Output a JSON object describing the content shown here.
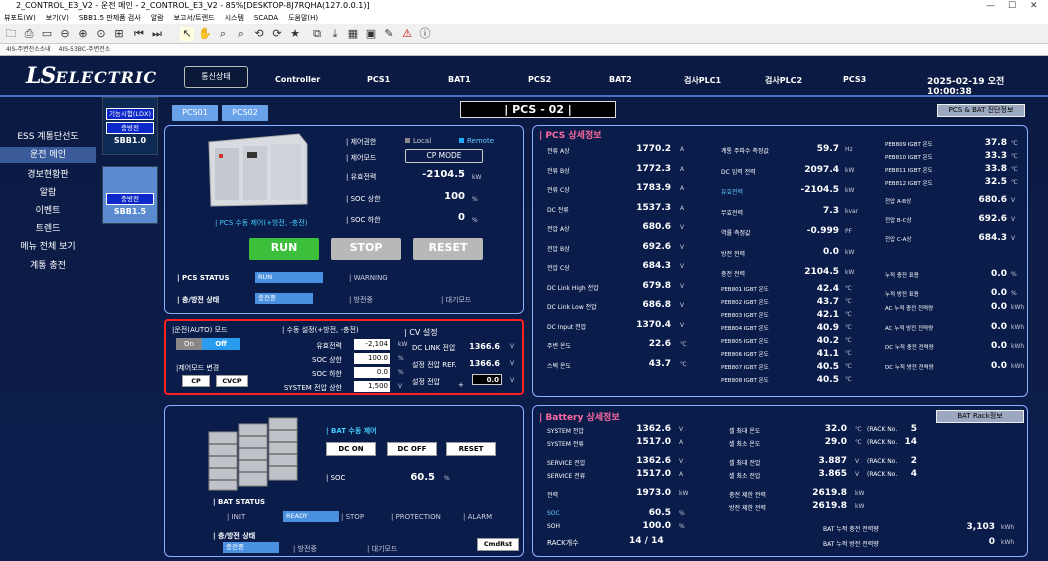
{
  "window": {
    "title": "2_CONTROL_E3_V2 - 운전 메인 - 2_CONTROL_E3_V2 - 85%[DESKTOP-8J7RQHA(127.0.0.1)]",
    "controls": [
      "—",
      "☐",
      "✕"
    ]
  },
  "menubar": [
    "뷰포트(W)",
    "보기(V)",
    "SBB1.5 판제품 검사",
    "알람",
    "보고서/트렌드",
    "시스템",
    "SCADA",
    "도움말(H)"
  ],
  "tabbar": [
    "4IS-주변전소소내",
    "4IS-53BC-주변전소"
  ],
  "header": {
    "logo_main": "LS",
    "logo_sub": "ELECTRIC",
    "nav": [
      "통신상태",
      "Controller",
      "PCS1",
      "BAT1",
      "PCS2",
      "BAT2",
      "검사PLC1",
      "검사PLC2",
      "PCS3"
    ],
    "datetime": "2025-02-19 오전 10:00:38"
  },
  "leftmenu": [
    "ESS 계통단선도",
    "운전 메인",
    "경보현황판",
    "알람",
    "이벤트",
    "트렌드",
    "메뉴 전체 보기",
    "계통 충전"
  ],
  "sbb": [
    {
      "badge1": "기능시험(LDX)",
      "badge2": "충방전",
      "name": "SBB1.0"
    },
    {
      "badge1": "충방전",
      "name": "SBB1.5"
    }
  ],
  "pcs_tabs": [
    "PCS01",
    "PCS02"
  ],
  "pcs_title": "|  PCS - 02  |",
  "diag_button": "PCS & BAT 진단정보",
  "pcs_panel": {
    "auth_label": "| 제어권한",
    "local": "Local",
    "remote": "Remote",
    "mode_label": "| 제어모드",
    "mode_value": "CP MODE",
    "power_label": "| 유효전력",
    "power_value": "-2104.5",
    "power_unit": "kW",
    "soc_hi_label": "| SOC 상한",
    "soc_hi_value": "100",
    "soc_hi_unit": "%",
    "soc_lo_label": "| SOC 하한",
    "soc_lo_value": "0",
    "soc_lo_unit": "%",
    "manual_label": "| PCS 수동 제어(+방전, -충전)",
    "run": "RUN",
    "stop": "STOP",
    "reset": "RESET",
    "status_label": "| PCS STATUS",
    "status_run": "RUN",
    "status_warn": "| WARNING",
    "cd_label": "| 충/방전 상태",
    "cd_charge": "충전중",
    "cd_discharge": "| 방전중",
    "cd_idle": "| 대기모드"
  },
  "auto_panel": {
    "auto_label": "|운전(AUTO) 모드",
    "on": "On",
    "off": "Off",
    "ctrl_label": "|제어모드 변경",
    "cp": "CP",
    "cvcp": "CVCP",
    "manual_label": "| 수동 설정(+방전, -충전)",
    "rows": [
      {
        "l": "유효전력",
        "v": "-2,104",
        "u": "kW"
      },
      {
        "l": "SOC 상한",
        "v": "100.0",
        "u": "%"
      },
      {
        "l": "SOC 하한",
        "v": "0.0",
        "u": "%"
      },
      {
        "l": "SYSTEM 전압 상한",
        "v": "1,500",
        "u": "V"
      }
    ],
    "cv_label": "| CV 설정",
    "cv_rows": [
      {
        "l": "DC LINK 전압",
        "v": "1366.6",
        "u": "V"
      },
      {
        "l": "설정 전압 REF.",
        "v": "1366.6",
        "u": "V"
      },
      {
        "l": "설정 전압",
        "v": "0.0",
        "u": "V"
      }
    ],
    "plus": "+"
  },
  "pcs_detail": {
    "title": "| PCS 상세정보",
    "col1": [
      {
        "l": "전류 A상",
        "v": "1770.2",
        "u": "A"
      },
      {
        "l": "전류 B상",
        "v": "1772.3",
        "u": "A"
      },
      {
        "l": "전류 C상",
        "v": "1783.9",
        "u": "A"
      },
      {
        "l": "DC 전류",
        "v": "1537.3",
        "u": "A"
      },
      {
        "l": "전압 A상",
        "v": "680.6",
        "u": "V"
      },
      {
        "l": "전압 B상",
        "v": "692.6",
        "u": "V"
      },
      {
        "l": "전압 C상",
        "v": "684.3",
        "u": "V"
      },
      {
        "l": "DC Link  High 전압",
        "v": "679.8",
        "u": "V"
      },
      {
        "l": "DC Link  Low 전압",
        "v": "686.8",
        "u": "V"
      },
      {
        "l": "DC Input 전압",
        "v": "1370.4",
        "u": "V"
      },
      {
        "l": "주변 온도",
        "v": "22.6",
        "u": "℃"
      },
      {
        "l": "스택 온도",
        "v": "43.7",
        "u": "℃"
      }
    ],
    "col2": [
      {
        "l": "계통 주파수 측정값",
        "v": "59.7",
        "u": "Hz"
      },
      {
        "l": "DC 입력 전력",
        "v": "2097.4",
        "u": "kW"
      },
      {
        "l": "유효전력",
        "v": "-2104.5",
        "u": "kW"
      },
      {
        "l": "무효전력",
        "v": "7.3",
        "u": "kvar"
      },
      {
        "l": "역률 측정값",
        "v": "-0.999",
        "u": "PF"
      },
      {
        "l": "방전 전력",
        "v": "0.0",
        "u": "kW"
      },
      {
        "l": "충전 전력",
        "v": "2104.5",
        "u": "kW"
      }
    ],
    "igbt": [
      {
        "l": "PEB801 IGBT 온도",
        "v": "42.4"
      },
      {
        "l": "PEB802 IGBT 온도",
        "v": "43.7"
      },
      {
        "l": "PEB803 IGBT 온도",
        "v": "42.1"
      },
      {
        "l": "PEB804 IGBT 온도",
        "v": "40.9"
      },
      {
        "l": "PEB805 IGBT 온도",
        "v": "40.2"
      },
      {
        "l": "PEB806 IGBT 온도",
        "v": "41.1"
      },
      {
        "l": "PEB807 IGBT 온도",
        "v": "40.5"
      },
      {
        "l": "PEB808 IGBT 온도",
        "v": "40.5"
      }
    ],
    "col3": [
      {
        "l": "PEB809 IGBT 온도",
        "v": "37.8",
        "u": "℃"
      },
      {
        "l": "PEB810 IGBT 온도",
        "v": "33.3",
        "u": "℃"
      },
      {
        "l": "PEB811 IGBT 온도",
        "v": "33.8",
        "u": "℃"
      },
      {
        "l": "PEB812 IGBT 온도",
        "v": "32.5",
        "u": "℃"
      },
      {
        "l": "전압 A-B상",
        "v": "680.6",
        "u": "V"
      },
      {
        "l": "전압 B-C상",
        "v": "692.6",
        "u": "V"
      },
      {
        "l": "전압 C-A상",
        "v": "684.3",
        "u": "V"
      },
      {
        "l": "누적 충전 표용",
        "v": "0.0",
        "u": "%"
      },
      {
        "l": "누적 방전 표용",
        "v": "0.0",
        "u": "%"
      },
      {
        "l": "AC 누적 충전 전력량",
        "v": "0.0",
        "u": "kWh"
      },
      {
        "l": "AC 누적 방전 전력량",
        "v": "0.0",
        "u": "kWh"
      },
      {
        "l": "DC 누적 충전 전력량",
        "v": "0.0",
        "u": "kWh"
      },
      {
        "l": "DC 누적 방전 전력량",
        "v": "0.0",
        "u": "kWh"
      }
    ],
    "igbt_unit": "℃"
  },
  "bat_panel": {
    "manual_label": "| BAT 수동 제어",
    "dc_on": "DC ON",
    "dc_off": "DC OFF",
    "reset": "RESET",
    "soc_label": "| SOC",
    "soc_value": "60.5",
    "soc_unit": "%",
    "status_label": "| BAT STATUS",
    "s_init": "| INIT",
    "s_ready": "READY",
    "s_stop": "| STOP",
    "s_prot": "| PROTECTION",
    "s_alarm": "| ALARM",
    "cd_label": "| 충/방전 상태",
    "cd_charge": "충전중",
    "cd_discharge": "| 방전중",
    "cd_idle": "| 대기모드",
    "cmd": "CmdRst"
  },
  "bat_detail": {
    "title": "| Battery 상세정보",
    "rack_btn": "BAT Rack정보",
    "col1": [
      {
        "l": "SYSTEM 전압",
        "v": "1362.6",
        "u": "V"
      },
      {
        "l": "SYSTEM 전류",
        "v": "1517.0",
        "u": "A"
      },
      {
        "l": "SERVICE 전압",
        "v": "1362.6",
        "u": "V"
      },
      {
        "l": "SERVICE 전류",
        "v": "1517.0",
        "u": "A"
      },
      {
        "l": "전력",
        "v": "1973.0",
        "u": "kW"
      },
      {
        "l": "SOC",
        "v": "60.5",
        "u": "%"
      },
      {
        "l": "SOH",
        "v": "100.0",
        "u": "%"
      }
    ],
    "rack_label": "RACK개수",
    "rack_value": "14  /  14",
    "col2": [
      {
        "l": "셀 최대 온도",
        "v": "32.0",
        "u": "℃",
        "r": "(RACK No.",
        "n": "5"
      },
      {
        "l": "셀 최소 온도",
        "v": "29.0",
        "u": "℃",
        "r": "(RACK No.",
        "n": "14"
      },
      {
        "l": "셀 최대 전압",
        "v": "3.887",
        "u": "V",
        "r": "(RACK No.",
        "n": "2"
      },
      {
        "l": "셀 최소 전압",
        "v": "3.865",
        "u": "V",
        "r": "(RACK No.",
        "n": "4"
      },
      {
        "l": "충전 제한 전력",
        "v": "2619.8",
        "u": "kW"
      },
      {
        "l": "방전 제한 전력",
        "v": "2619.8",
        "u": "kW"
      }
    ],
    "acc": [
      {
        "l": "BAT 누적 충전 전력량",
        "v": "3,103",
        "u": "kWh"
      },
      {
        "l": "BAT 누적 방전 전력량",
        "v": "0",
        "u": "kWh"
      }
    ]
  }
}
